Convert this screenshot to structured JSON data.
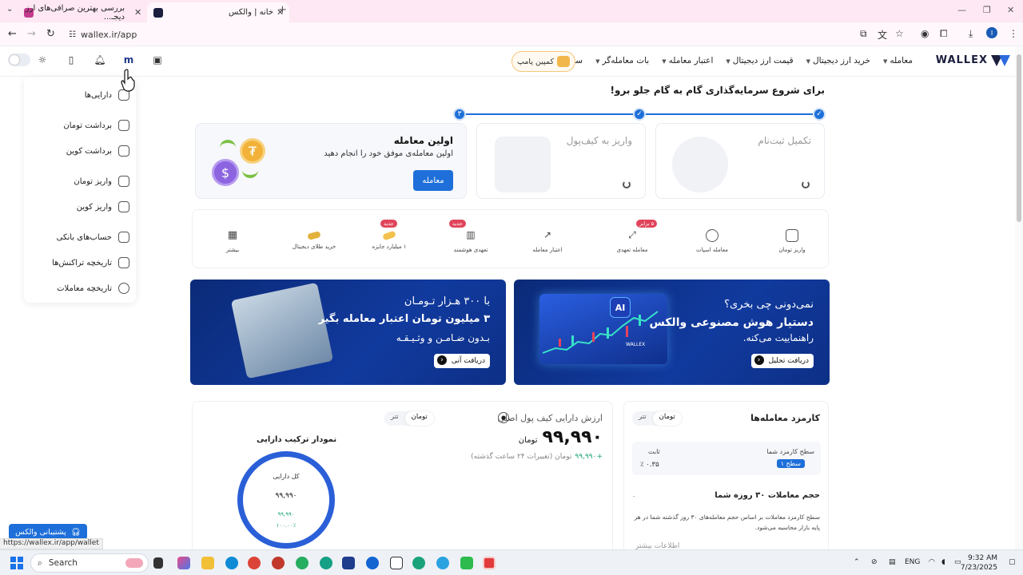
{
  "browser": {
    "tabs": [
      {
        "title": "بررسی بهترین صرافی‌های ارز دیجـ...",
        "active": false
      },
      {
        "title": "خانه | والکس",
        "active": true
      }
    ],
    "url": "wallex.ir/app",
    "status_url": "https://wallex.ir/app/wallet"
  },
  "header": {
    "logo": "WALLEX",
    "nav": [
      "معامله",
      "خرید ارز دیجیتال",
      "قیمت ارز دیجیتال",
      "اعتبار معامله",
      "بات معامله‌گر",
      "سایر"
    ],
    "promo_label": "کمپین پامپ"
  },
  "dropdown": {
    "items": [
      {
        "label": "دارایی‌ها",
        "icon": "wallet-icon"
      },
      {
        "label": "برداشت تومان",
        "icon": "withdraw-toman-icon"
      },
      {
        "label": "برداشت کوین",
        "icon": "withdraw-coin-icon"
      },
      {
        "label": "واریز تومان",
        "icon": "deposit-toman-icon"
      },
      {
        "label": "واریز کوین",
        "icon": "deposit-coin-icon"
      },
      {
        "label": "حساب‌های بانکی",
        "icon": "bank-card-icon"
      },
      {
        "label": "تاریخچه تراکنش‌ها",
        "icon": "transactions-history-icon"
      },
      {
        "label": "تاریخچه معاملات",
        "icon": "trades-history-icon"
      }
    ]
  },
  "onboarding": {
    "headline": "برای شروع سرمایه‌گذاری گام به گام جلو برو!",
    "steps": [
      {
        "title": "تکمیل ثبت‌نام"
      },
      {
        "title": "واریز به کیف‌پول"
      },
      {
        "title": "اولین معامله",
        "subtitle": "اولین معامله‌ی موفق خود را انجام دهید",
        "button": "معامله"
      }
    ],
    "step_number": "۳"
  },
  "quick_actions": [
    {
      "label": "واریز تومان",
      "badge": ""
    },
    {
      "label": "معامله اسپات",
      "badge": ""
    },
    {
      "label": "معامله تعهدی",
      "badge": "۵ برابر"
    },
    {
      "label": "اعتبار معامله",
      "badge": ""
    },
    {
      "label": "تعهدی هوشمند",
      "badge": "جدید"
    },
    {
      "label": "۱ میلیارد جایزه",
      "badge": "جدید"
    },
    {
      "label": "خرید طلای دیجیتال",
      "badge": ""
    },
    {
      "label": "بیشتر",
      "badge": ""
    }
  ],
  "banners": {
    "ai": {
      "line1": "نمی‌دونی چی بخری؟",
      "line2": "دستیار هوش مصنوعی والکس",
      "line3": "راهنماییت می‌کنه.",
      "button": "دریافت تحلیل",
      "badge": "AI",
      "brand": "WALLEX"
    },
    "credit": {
      "line1": "با ۳۰۰ هـزار تـومـان",
      "line2": "۳ میلیون تومان اعتبار معامله بگیر",
      "line3": "بـدون ضـامـن و وثـیـقـه",
      "button": "دریافت آنی"
    }
  },
  "wallet": {
    "title": "ارزش دارایی کیف پول اصلی",
    "currency_toggle": [
      "تومان",
      "تتر"
    ],
    "value": "۹۹,۹۹۰",
    "unit": "تومان",
    "change_value": "+۹۹,۹۹۰",
    "change_note": "تومان (تغییرات ۲۴ ساعت گذشته)",
    "chart_title": "نمودار ترکیب دارایی",
    "donut_label": "کل دارایی",
    "donut_value": "۹۹,۹۹۰",
    "donut_change": "۹۹,۹۹۰",
    "donut_percent": "۱۰۰.۰۰٪"
  },
  "fees": {
    "title": "کارمزد معامله‌ها",
    "currency_toggle": [
      "تومان",
      "تتر"
    ],
    "level_label": "سطح کارمزد شما",
    "level_badge": "سطح ۱",
    "fixed_label": "ثابت",
    "fixed_value": "۰.۳۵ ٪",
    "volume_title": "حجم معاملات ۳۰ روزه شما",
    "volume_value": "۰",
    "note": "سطح کارمزد معاملات بر اساس حجم معامله‌های ۳۰ روز گذشته شما در هر پایه بازار محاسبه می‌شود.",
    "more": "اطلاعات بیشتر"
  },
  "support": {
    "label": "پشتیبانی والکس"
  },
  "taskbar": {
    "search": "Search",
    "lang": "ENG",
    "time": "9:32 AM",
    "date": "7/23/2025"
  },
  "colors": {
    "primary": "#1e6fd9",
    "brand_dark": "#1b1e3d",
    "tab_bg": "#fde8f3",
    "success": "#1aa37a"
  }
}
